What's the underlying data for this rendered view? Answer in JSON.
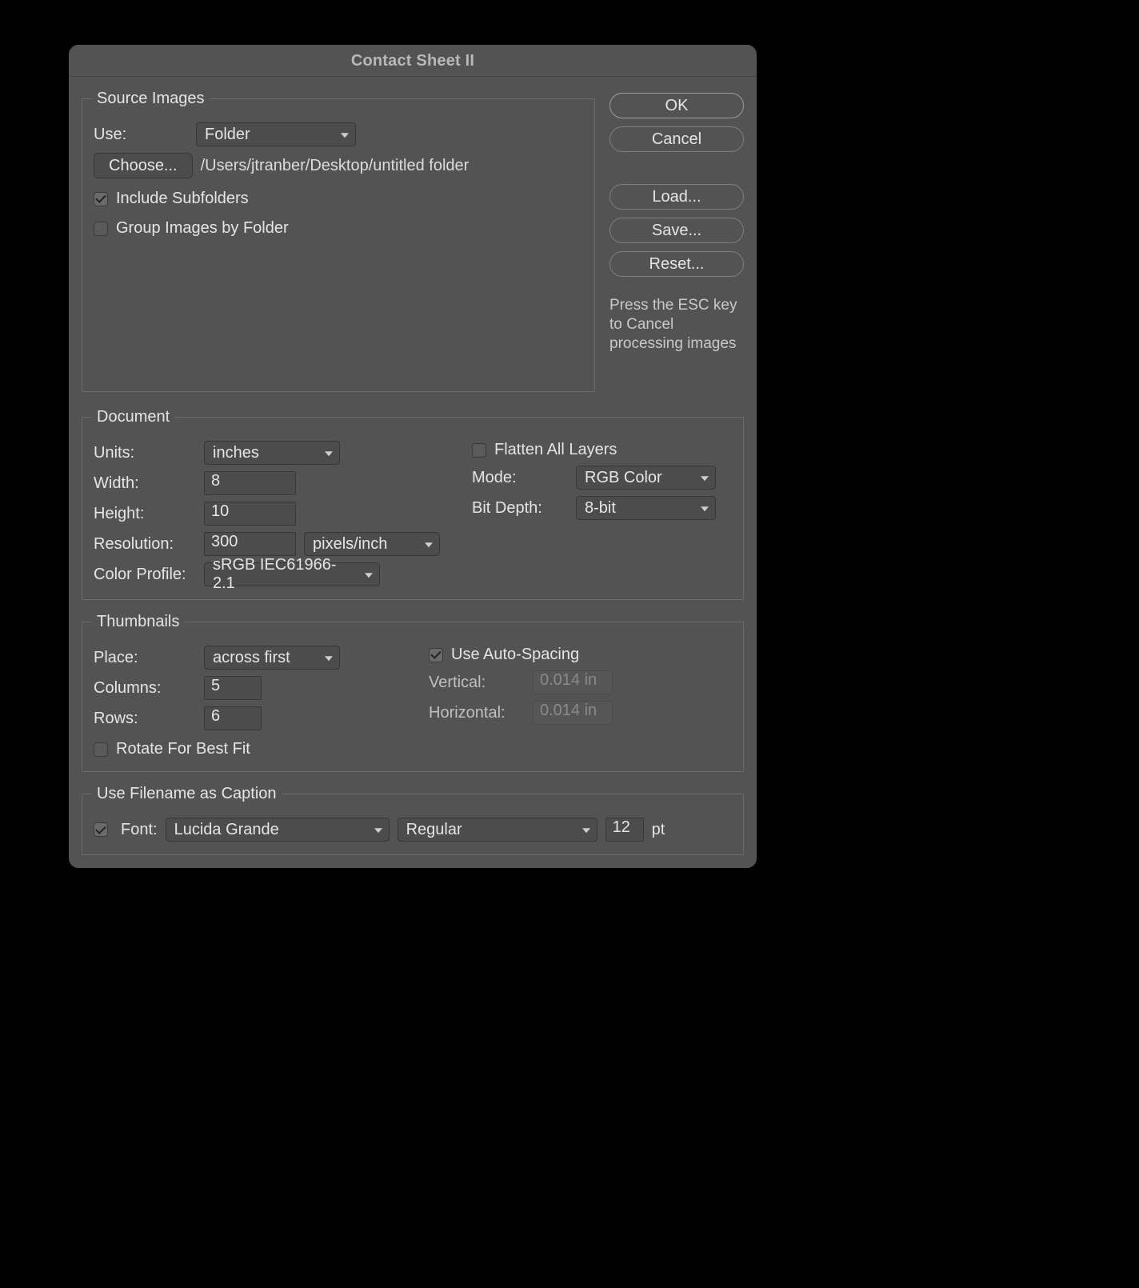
{
  "dialog": {
    "title": "Contact Sheet II"
  },
  "buttons": {
    "ok": "OK",
    "cancel": "Cancel",
    "load": "Load...",
    "save": "Save...",
    "reset": "Reset...",
    "choose": "Choose..."
  },
  "hint": "Press the ESC key to Cancel processing images",
  "source": {
    "legend": "Source Images",
    "use_label": "Use:",
    "use_value": "Folder",
    "path": "/Users/jtranber/Desktop/untitled folder",
    "include_sub": "Include Subfolders",
    "group_by_folder": "Group Images by Folder"
  },
  "document": {
    "legend": "Document",
    "units_label": "Units:",
    "units_value": "inches",
    "width_label": "Width:",
    "width_value": "8",
    "height_label": "Height:",
    "height_value": "10",
    "resolution_label": "Resolution:",
    "resolution_value": "300",
    "resolution_units": "pixels/inch",
    "color_profile_label": "Color Profile:",
    "color_profile_value": "sRGB IEC61966-2.1",
    "flatten_label": "Flatten All Layers",
    "mode_label": "Mode:",
    "mode_value": "RGB Color",
    "bit_label": "Bit Depth:",
    "bit_value": "8-bit"
  },
  "thumbs": {
    "legend": "Thumbnails",
    "place_label": "Place:",
    "place_value": "across first",
    "columns_label": "Columns:",
    "columns_value": "5",
    "rows_label": "Rows:",
    "rows_value": "6",
    "rotate_label": "Rotate For Best Fit",
    "auto_label": "Use Auto-Spacing",
    "vertical_label": "Vertical:",
    "vertical_value": "0.014 in",
    "horizontal_label": "Horizontal:",
    "horizontal_value": "0.014 in"
  },
  "caption": {
    "legend": "Use Filename as Caption",
    "font_label": "Font:",
    "font_value": "Lucida Grande",
    "style_value": "Regular",
    "size_value": "12",
    "unit": "pt"
  }
}
